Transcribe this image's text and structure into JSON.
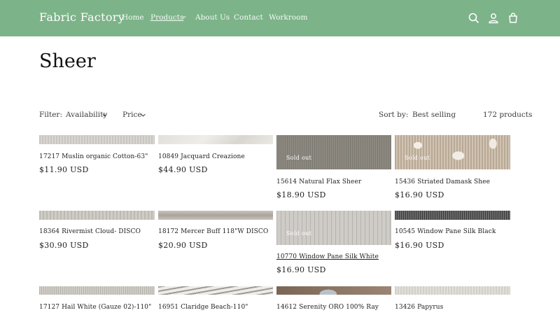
{
  "header": {
    "brand": "Fabric Factory",
    "nav": {
      "home": "Home",
      "products": "Products",
      "about": "About Us",
      "contact": "Contact",
      "workroom": "Workroom"
    },
    "icons": [
      "search-icon",
      "account-icon",
      "cart-icon"
    ],
    "background_color": "#7db389"
  },
  "page": {
    "title": "Sheer"
  },
  "filters": {
    "label": "Filter:",
    "availability": "Availability",
    "price": "Price",
    "sort_label": "Sort by:",
    "sort_value": "Best selling",
    "count": "172 products"
  },
  "products": [
    {
      "title": "17217 Muslin organic Cotton-63\"",
      "price": "$11.90 USD",
      "sold_out": ""
    },
    {
      "title": "10849 Jacquard Creazione",
      "price": "$44.90 USD",
      "sold_out": ""
    },
    {
      "title": "15614 Natural Flax Sheer",
      "price": "$18.90 USD",
      "sold_out": "Sold out"
    },
    {
      "title": "15436 Striated Damask Shee",
      "price": "$16.90 USD",
      "sold_out": "Sold out"
    },
    {
      "title": "18364 Rivermist Cloud- DISCO",
      "price": "$30.90 USD",
      "sold_out": ""
    },
    {
      "title": "18172 Mercer Buff 118\"W DISCO",
      "price": "$20.90 USD",
      "sold_out": ""
    },
    {
      "title": "10770 Window Pane Silk White",
      "price": "$16.90 USD",
      "sold_out": "Sold out"
    },
    {
      "title": "10545 Window Pane Silk Black",
      "price": "$16.90 USD",
      "sold_out": ""
    },
    {
      "title": "17127 Hail White (Gauze 02)-110\"",
      "price": "",
      "sold_out": ""
    },
    {
      "title": "16951 Claridge Beach-110\"",
      "price": "",
      "sold_out": ""
    },
    {
      "title": "14612 Serenity ORO 100% Ray",
      "price": "",
      "sold_out": ""
    },
    {
      "title": "13426 Papyrus",
      "price": "",
      "sold_out": ""
    }
  ]
}
